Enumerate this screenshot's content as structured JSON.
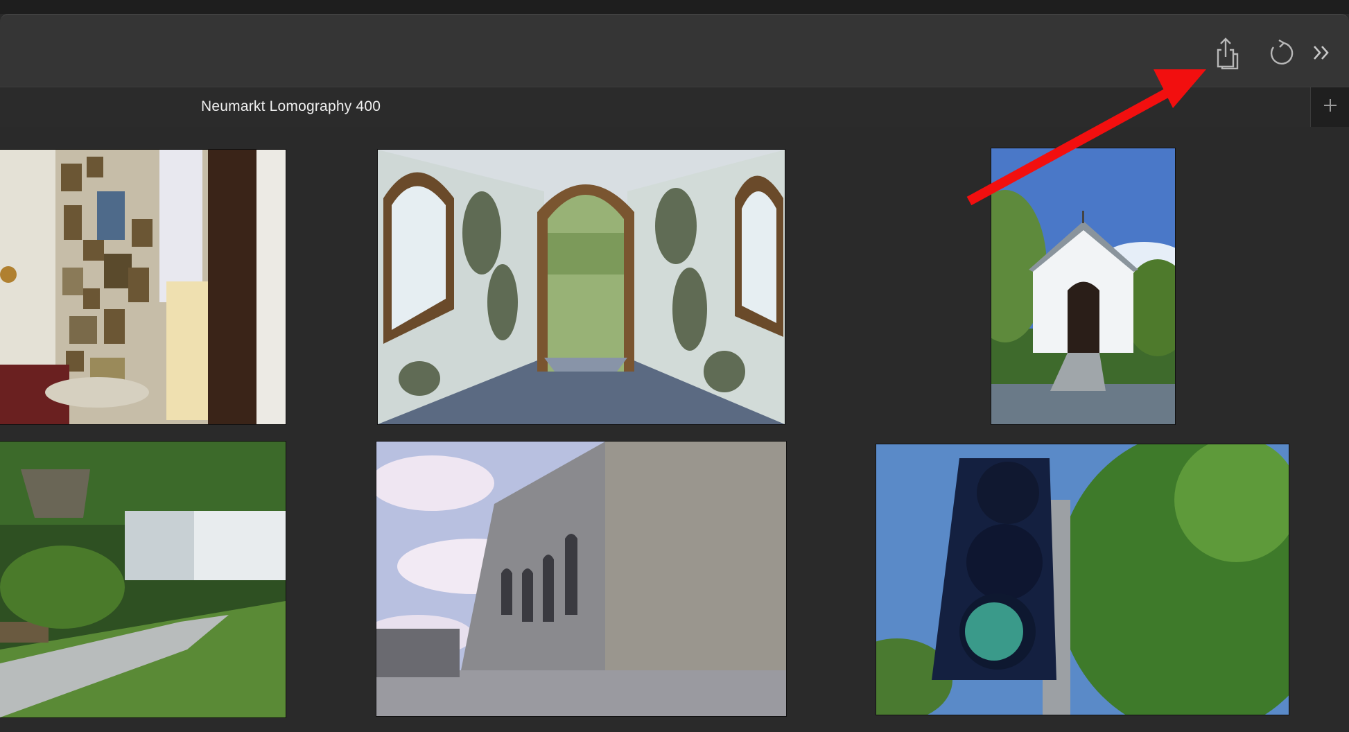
{
  "window": {
    "tab_title": "Neumarkt Lomography 400"
  },
  "toolbar": {
    "buttons": [
      {
        "name": "share",
        "icon": "share-icon"
      },
      {
        "name": "reload",
        "icon": "reload-icon"
      },
      {
        "name": "more",
        "icon": "chevron-double-right-icon"
      }
    ],
    "new_tab_icon": "plus-icon"
  },
  "gallery": {
    "photos": [
      {
        "subject": "chapel interior with devotional pictures"
      },
      {
        "subject": "arched doorway with peeling walls"
      },
      {
        "subject": "small white chapel"
      },
      {
        "subject": "overgrown path with shed"
      },
      {
        "subject": "castle ruin walls"
      },
      {
        "subject": "traffic light with trees"
      }
    ]
  },
  "colors": {
    "annotation_arrow": "#f20f0f",
    "background": "#2a2a2a",
    "toolbar": "#353535"
  }
}
